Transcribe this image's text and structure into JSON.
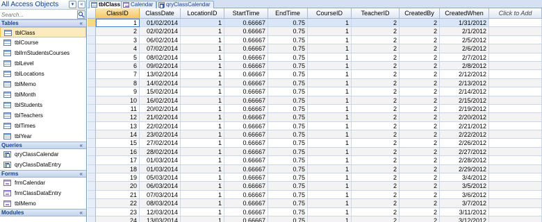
{
  "nav": {
    "title": "All Access Objects",
    "search_placeholder": "Search...",
    "groups": [
      {
        "title": "Tables",
        "collapse": "«",
        "items": [
          {
            "label": "tblClass",
            "icon": "table-icon",
            "selected": true
          },
          {
            "label": "tblCourse",
            "icon": "table-icon"
          },
          {
            "label": "tblIrnStudentsCourses",
            "icon": "table-icon"
          },
          {
            "label": "tblLevel",
            "icon": "table-icon"
          },
          {
            "label": "tblLocations",
            "icon": "table-icon"
          },
          {
            "label": "tblMemo",
            "icon": "table-icon"
          },
          {
            "label": "tblMonth",
            "icon": "table-icon"
          },
          {
            "label": "tblStudents",
            "icon": "table-icon"
          },
          {
            "label": "tblTeachers",
            "icon": "table-icon"
          },
          {
            "label": "tblTimes",
            "icon": "table-icon"
          },
          {
            "label": "tblYear",
            "icon": "table-icon"
          }
        ]
      },
      {
        "title": "Queries",
        "collapse": "«",
        "items": [
          {
            "label": "qryClassCalendar",
            "icon": "query-icon"
          },
          {
            "label": "qryClassDataEntry",
            "icon": "query-icon"
          }
        ]
      },
      {
        "title": "Forms",
        "collapse": "«",
        "items": [
          {
            "label": "frmCalendar",
            "icon": "form-icon"
          },
          {
            "label": "frmClassDataEntry",
            "icon": "form-icon"
          },
          {
            "label": "tblMemo",
            "icon": "form-icon"
          }
        ]
      },
      {
        "title": "Modules",
        "collapse": "«",
        "items": []
      }
    ]
  },
  "tabs": [
    {
      "label": "tblClass",
      "active": true,
      "icon": "table-icon"
    },
    {
      "label": "Calendar",
      "icon": "form-icon"
    },
    {
      "label": "qryClassCalendar",
      "icon": "query-icon"
    }
  ],
  "datasheet": {
    "columns": [
      "ClassID",
      "ClassDate",
      "LocationID",
      "StartTime",
      "EndTime",
      "CourseID",
      "TeacherID",
      "CreatedBy",
      "CreatedWhen",
      "Click to Add"
    ],
    "rows": [
      [
        "1",
        "01/02/2014",
        "1",
        "0.66667",
        "0.75",
        "1",
        "2",
        "2",
        "1/31/2012"
      ],
      [
        "2",
        "02/02/2014",
        "1",
        "0.66667",
        "0.75",
        "1",
        "2",
        "2",
        "2/1/2012"
      ],
      [
        "3",
        "06/02/2014",
        "1",
        "0.66667",
        "0.75",
        "1",
        "2",
        "2",
        "2/5/2012"
      ],
      [
        "4",
        "07/02/2014",
        "1",
        "0.66667",
        "0.75",
        "1",
        "2",
        "2",
        "2/6/2012"
      ],
      [
        "5",
        "08/02/2014",
        "1",
        "0.66667",
        "0.75",
        "1",
        "2",
        "2",
        "2/7/2012"
      ],
      [
        "6",
        "09/02/2014",
        "1",
        "0.66667",
        "0.75",
        "1",
        "2",
        "2",
        "2/8/2012"
      ],
      [
        "7",
        "13/02/2014",
        "1",
        "0.66667",
        "0.75",
        "1",
        "2",
        "2",
        "2/12/2012"
      ],
      [
        "8",
        "14/02/2014",
        "1",
        "0.66667",
        "0.75",
        "1",
        "2",
        "2",
        "2/13/2012"
      ],
      [
        "9",
        "15/02/2014",
        "1",
        "0.66667",
        "0.75",
        "1",
        "2",
        "2",
        "2/14/2012"
      ],
      [
        "10",
        "16/02/2014",
        "1",
        "0.66667",
        "0.75",
        "1",
        "2",
        "2",
        "2/15/2012"
      ],
      [
        "11",
        "20/02/2014",
        "1",
        "0.66667",
        "0.75",
        "1",
        "2",
        "2",
        "2/19/2012"
      ],
      [
        "12",
        "21/02/2014",
        "1",
        "0.66667",
        "0.75",
        "1",
        "2",
        "2",
        "2/20/2012"
      ],
      [
        "13",
        "22/02/2014",
        "1",
        "0.66667",
        "0.75",
        "1",
        "2",
        "2",
        "2/21/2012"
      ],
      [
        "14",
        "23/02/2014",
        "1",
        "0.66667",
        "0.75",
        "1",
        "2",
        "2",
        "2/22/2012"
      ],
      [
        "15",
        "27/02/2014",
        "1",
        "0.66667",
        "0.75",
        "1",
        "2",
        "2",
        "2/26/2012"
      ],
      [
        "16",
        "28/02/2014",
        "1",
        "0.66667",
        "0.75",
        "1",
        "2",
        "2",
        "2/27/2012"
      ],
      [
        "17",
        "01/03/2014",
        "1",
        "0.66667",
        "0.75",
        "1",
        "2",
        "2",
        "2/28/2012"
      ],
      [
        "18",
        "01/03/2014",
        "1",
        "0.66667",
        "0.75",
        "1",
        "2",
        "2",
        "2/29/2012"
      ],
      [
        "19",
        "05/03/2014",
        "1",
        "0.66667",
        "0.75",
        "1",
        "2",
        "2",
        "3/4/2012"
      ],
      [
        "20",
        "06/03/2014",
        "1",
        "0.66667",
        "0.75",
        "1",
        "2",
        "2",
        "3/5/2012"
      ],
      [
        "21",
        "07/03/2014",
        "1",
        "0.66667",
        "0.75",
        "1",
        "2",
        "2",
        "3/6/2012"
      ],
      [
        "22",
        "08/03/2014",
        "1",
        "0.66667",
        "0.75",
        "1",
        "2",
        "2",
        "3/7/2012"
      ],
      [
        "23",
        "12/03/2014",
        "1",
        "0.66667",
        "0.75",
        "1",
        "2",
        "2",
        "3/11/2012"
      ],
      [
        "24",
        "13/03/2014",
        "1",
        "0.66667",
        "0.75",
        "1",
        "2",
        "2",
        "3/12/2012"
      ]
    ]
  },
  "colors": {
    "accent": "#15428b",
    "selected_row": "#d9e6f7",
    "selected_header": "#f7c765"
  }
}
